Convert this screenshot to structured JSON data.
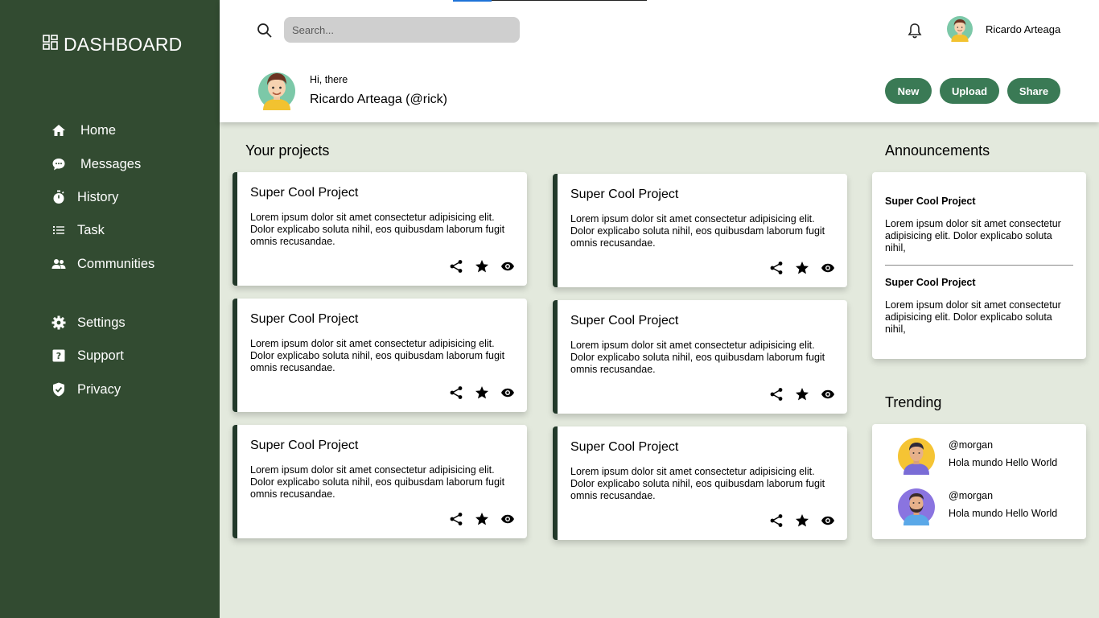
{
  "sidebar": {
    "brand": "DASHBOARD",
    "items": [
      {
        "label": "Home",
        "icon": "home-icon"
      },
      {
        "label": "Messages",
        "icon": "chat-bubble-icon"
      },
      {
        "label": "History",
        "icon": "stopwatch-icon"
      },
      {
        "label": "Task",
        "icon": "list-icon"
      },
      {
        "label": "Communities",
        "icon": "people-icon"
      },
      {
        "label": "Settings",
        "icon": "gear-icon"
      },
      {
        "label": "Support",
        "icon": "help-icon"
      },
      {
        "label": "Privacy",
        "icon": "shield-check-icon"
      }
    ]
  },
  "header": {
    "search_placeholder": "Search...",
    "username": "Ricardo Arteaga",
    "greeting": "Hi, there",
    "display_name": "Ricardo Arteaga (@rick)",
    "buttons": {
      "new": "New",
      "upload": "Upload",
      "share": "Share"
    }
  },
  "projects": {
    "title": "Your projects",
    "cards": [
      {
        "title": "Super Cool Project",
        "text": "Lorem ipsum dolor sit amet consectetur adipisicing elit. Dolor explicabo soluta nihil, eos quibusdam laborum fugit omnis recusandae."
      },
      {
        "title": "Super Cool Project",
        "text": "Lorem ipsum dolor sit amet consectetur adipisicing elit. Dolor explicabo soluta nihil, eos quibusdam laborum fugit omnis recusandae."
      },
      {
        "title": "Super Cool Project",
        "text": "Lorem ipsum dolor sit amet consectetur adipisicing elit. Dolor explicabo soluta nihil, eos quibusdam laborum fugit omnis recusandae."
      },
      {
        "title": "Super Cool Project",
        "text": "Lorem ipsum dolor sit amet consectetur adipisicing elit. Dolor explicabo soluta nihil, eos quibusdam laborum fugit omnis recusandae."
      },
      {
        "title": "Super Cool Project",
        "text": "Lorem ipsum dolor sit amet consectetur adipisicing elit. Dolor explicabo soluta nihil, eos quibusdam laborum fugit omnis recusandae."
      },
      {
        "title": "Super Cool Project",
        "text": "Lorem ipsum dolor sit amet consectetur adipisicing elit. Dolor explicabo soluta nihil, eos quibusdam laborum fugit omnis recusandae."
      }
    ]
  },
  "announcements": {
    "title": "Announcements",
    "items": [
      {
        "title": "Super Cool Project",
        "text": "Lorem ipsum dolor sit amet consectetur adipisicing elit. Dolor explicabo soluta nihil,"
      },
      {
        "title": "Super Cool Project",
        "text": "Lorem ipsum dolor sit amet consectetur adipisicing elit. Dolor explicabo soluta nihil,"
      }
    ]
  },
  "trending": {
    "title": "Trending",
    "items": [
      {
        "handle": "@morgan",
        "message": "Hola mundo Hello World"
      },
      {
        "handle": "@morgan",
        "message": "Hola mundo Hello World"
      }
    ]
  },
  "colors": {
    "sidebar_bg": "#324b31",
    "page_bg": "#e3e9dd",
    "button_bg": "#3a7a55",
    "card_accent": "#22392a"
  }
}
